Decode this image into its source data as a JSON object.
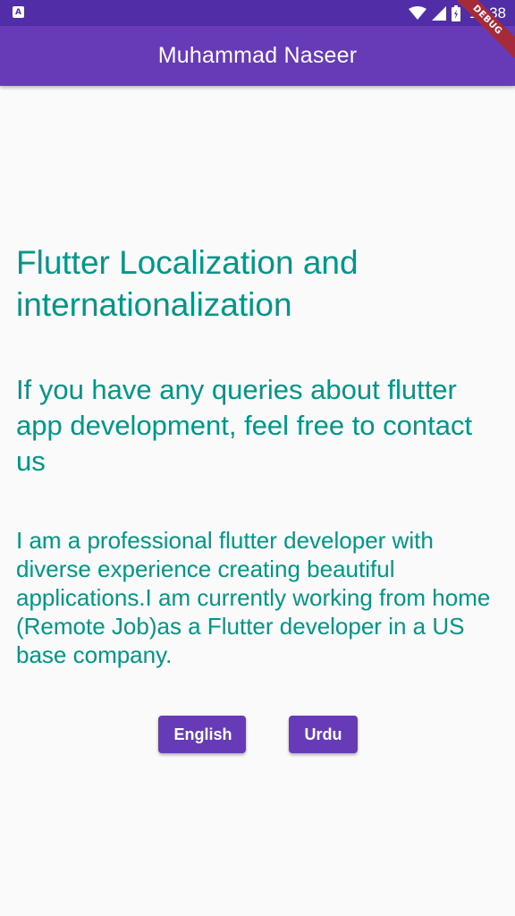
{
  "status_bar": {
    "left_icon": "A",
    "left_icon_name": "notification-a-icon",
    "time": "11:38",
    "icons": [
      "wifi-icon",
      "signal-icon",
      "battery-icon"
    ]
  },
  "app_bar": {
    "title": "Muhammad Naseer"
  },
  "debug_banner": {
    "label": "DEBUG"
  },
  "main": {
    "heading": "Flutter Localization and internationalization",
    "subheading": "If you have any queries about flutter app development, feel free to contact us",
    "body": "I am a professional flutter developer with diverse experience creating beautiful applications.I am currently working from home (Remote Job)as a Flutter developer in a US base company."
  },
  "buttons": {
    "english_label": "English",
    "urdu_label": "Urdu"
  },
  "colors": {
    "status_bar": "#512da8",
    "app_bar": "#673ab7",
    "text_teal": "#009688",
    "button": "#673ab7",
    "background": "#fafafa",
    "debug": "#a52b3a"
  }
}
